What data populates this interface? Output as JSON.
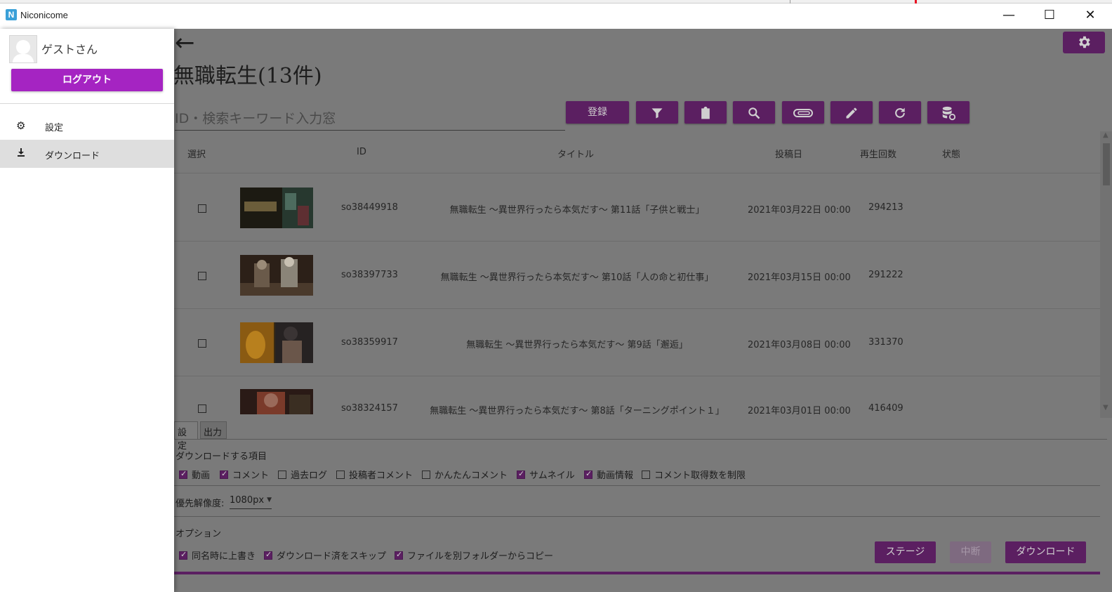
{
  "window": {
    "app_title": "Niconicome",
    "app_icon_letter": "N",
    "minimize_glyph": "—",
    "maximize_glyph": "☐",
    "close_glyph": "✕"
  },
  "drawer": {
    "username": "ゲストさん",
    "logout_label": "ログアウト",
    "nav": [
      {
        "label": "設定",
        "icon": "gear-icon"
      },
      {
        "label": "ダウンロード",
        "icon": "download-icon"
      }
    ]
  },
  "header": {
    "back_glyph": "←",
    "title": "無職転生(13件)",
    "search_placeholder": "ID・検索キーワード入力窓"
  },
  "toolbar": {
    "register_label": "登録",
    "icons": [
      "filter-icon",
      "clipboard-icon",
      "search-icon",
      "attachment-icon",
      "edit-icon",
      "refresh-icon",
      "database-sync-icon"
    ],
    "accent_color": "#5b1f61"
  },
  "table": {
    "columns": {
      "select": "選択",
      "id": "ID",
      "title": "タイトル",
      "date": "投稿日",
      "views": "再生回数",
      "status": "状態"
    },
    "rows": [
      {
        "id": "so38449918",
        "title": "無職転生 ～異世界行ったら本気だす～ 第11話「子供と戦士」",
        "date": "2021年03月22日 00:00",
        "views": "294213",
        "status": ""
      },
      {
        "id": "so38397733",
        "title": "無職転生 ～異世界行ったら本気だす～ 第10話「人の命と初仕事」",
        "date": "2021年03月15日 00:00",
        "views": "291222",
        "status": ""
      },
      {
        "id": "so38359917",
        "title": "無職転生 ～異世界行ったら本気だす～ 第9話「邂逅」",
        "date": "2021年03月08日 00:00",
        "views": "331370",
        "status": ""
      },
      {
        "id": "so38324157",
        "title": "無職転生 ～異世界行ったら本気だす～ 第8話「ターニングポイント１」",
        "date": "2021年03月01日 00:00",
        "views": "416409",
        "status": ""
      }
    ]
  },
  "download_panel": {
    "tabs": [
      "設定",
      "出力"
    ],
    "items_label": "ダウンロードする項目",
    "items": [
      {
        "label": "動画",
        "checked": true
      },
      {
        "label": "コメント",
        "checked": true
      },
      {
        "label": "過去ログ",
        "checked": false
      },
      {
        "label": "投稿者コメント",
        "checked": false
      },
      {
        "label": "かんたんコメント",
        "checked": false
      },
      {
        "label": "サムネイル",
        "checked": true
      },
      {
        "label": "動画情報",
        "checked": true
      },
      {
        "label": "コメント取得数を制限",
        "checked": false
      }
    ],
    "resolution_label": "優先解像度:",
    "resolution_value": "1080px",
    "options_label": "オプション",
    "options": [
      {
        "label": "同名時に上書き",
        "checked": true
      },
      {
        "label": "ダウンロード済をスキップ",
        "checked": true
      },
      {
        "label": "ファイルを別フォルダーからコピー",
        "checked": true
      }
    ],
    "stage_label": "ステージ",
    "cancel_label": "中断",
    "download_label": "ダウンロード",
    "progress": 1.0
  }
}
